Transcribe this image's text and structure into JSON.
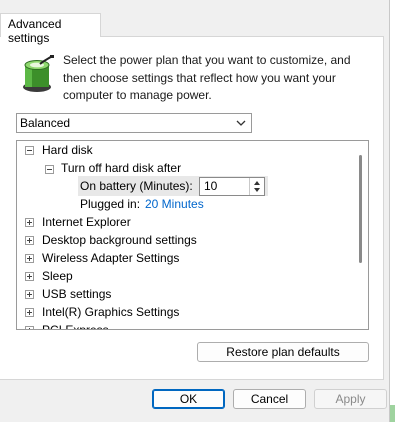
{
  "tab": {
    "label": "Advanced settings"
  },
  "description": "Select the power plan that you want to customize, and then choose settings that reflect how you want your computer to manage power.",
  "plan_select": {
    "value": "Balanced"
  },
  "tree": {
    "hard_disk": "Hard disk",
    "turn_off": "Turn off hard disk after",
    "on_battery_label": "On battery (Minutes):",
    "on_battery_value": "10",
    "plugged_in_label": "Plugged in:",
    "plugged_in_value": "20 Minutes",
    "items": [
      "Internet Explorer",
      "Desktop background settings",
      "Wireless Adapter Settings",
      "Sleep",
      "USB settings",
      "Intel(R) Graphics Settings",
      "PCI Express"
    ]
  },
  "buttons": {
    "restore": "Restore plan defaults",
    "ok": "OK",
    "cancel": "Cancel",
    "apply": "Apply"
  }
}
